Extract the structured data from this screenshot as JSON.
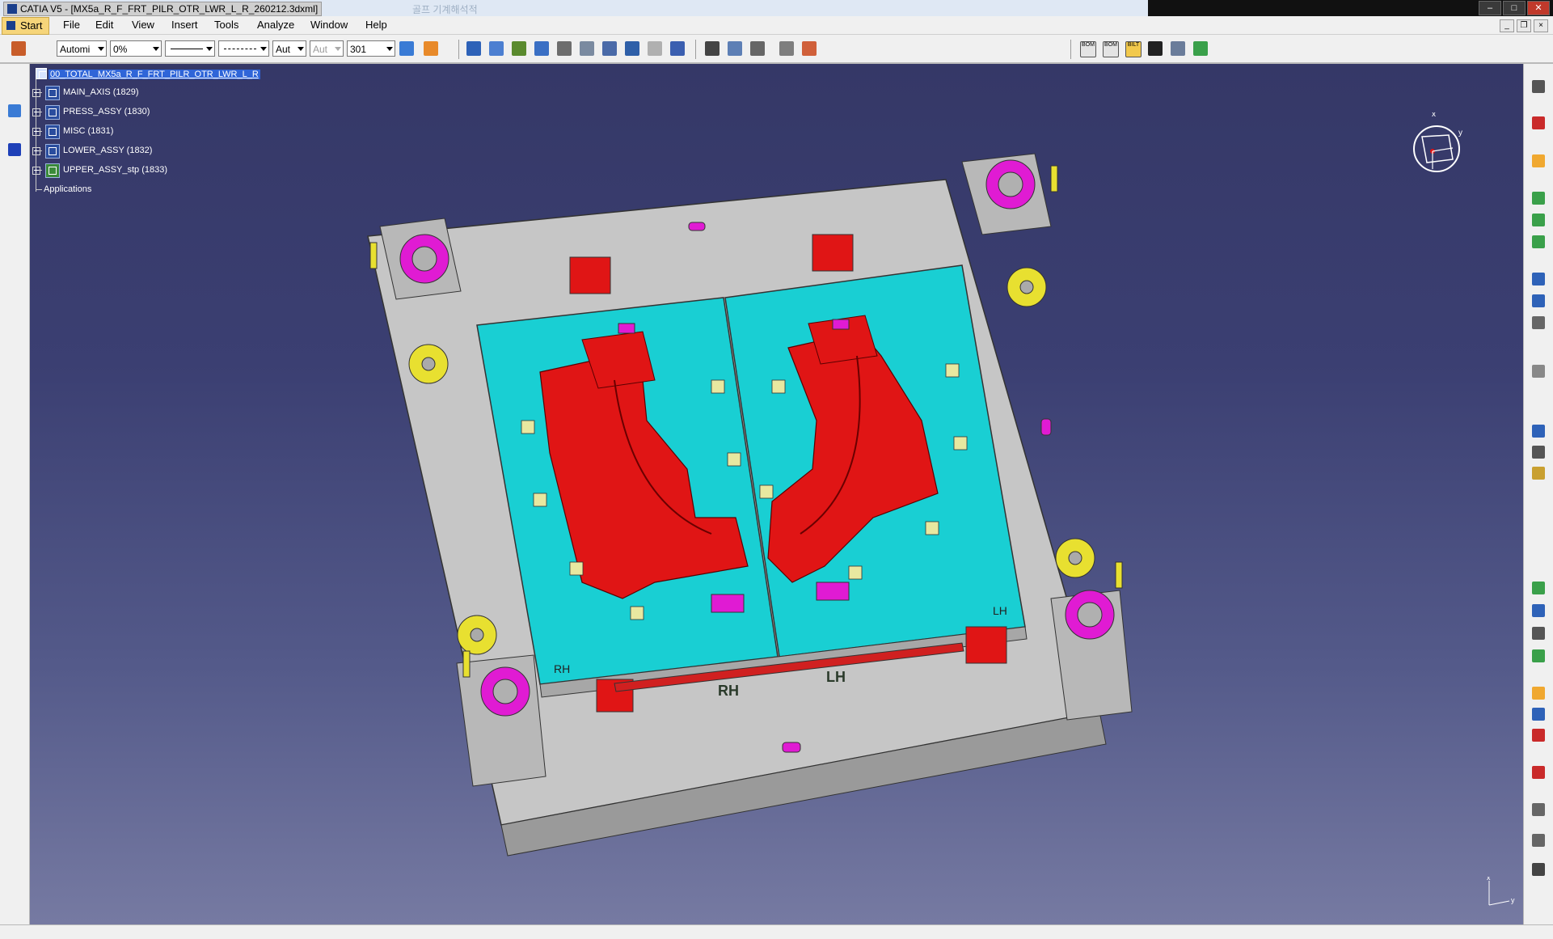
{
  "window": {
    "title": "CATIA V5 - [MX5a_R_F_FRT_PILR_OTR_LWR_L_R_260212.3dxml]",
    "ghost_text": "골프 기계해석적"
  },
  "menu": {
    "start": "Start",
    "items": [
      "File",
      "Edit",
      "View",
      "Insert",
      "Tools",
      "Analyze",
      "Window",
      "Help"
    ]
  },
  "toolbar": {
    "color_combo": "Automi",
    "transparency_combo": "0%",
    "line_weight_combo": "",
    "line_type_combo": "",
    "point_type_combo": "Aut",
    "layer_combo_disabled": "Aut",
    "layer_number": "301",
    "bom_labels": [
      "BOM",
      "BOM",
      "BILT"
    ]
  },
  "tree": {
    "root": "00_TOTAL_MX5a_R_F_FRT_PILR_OTR_LWR_L_R",
    "children": [
      {
        "label": "MAIN_AXIS (1829)"
      },
      {
        "label": "PRESS_ASSY (1830)"
      },
      {
        "label": "MISC (1831)"
      },
      {
        "label": "LOWER_ASSY (1832)"
      },
      {
        "label": "UPPER_ASSY_stp (1833)"
      }
    ],
    "applications": "Applications"
  },
  "model": {
    "labels": {
      "rh_small": "RH",
      "lh_small": "LH",
      "rh_large": "RH",
      "lh_large": "LH"
    },
    "colors": {
      "base": "#c8c8c8",
      "plate": "#19cfd3",
      "insert": "#e01515",
      "magenta": "#e01bd3",
      "yellow": "#e8e030"
    }
  },
  "compass": {
    "y_label": "y",
    "x_label": "x"
  },
  "axis_triad": {
    "x": "x",
    "y": "y"
  }
}
